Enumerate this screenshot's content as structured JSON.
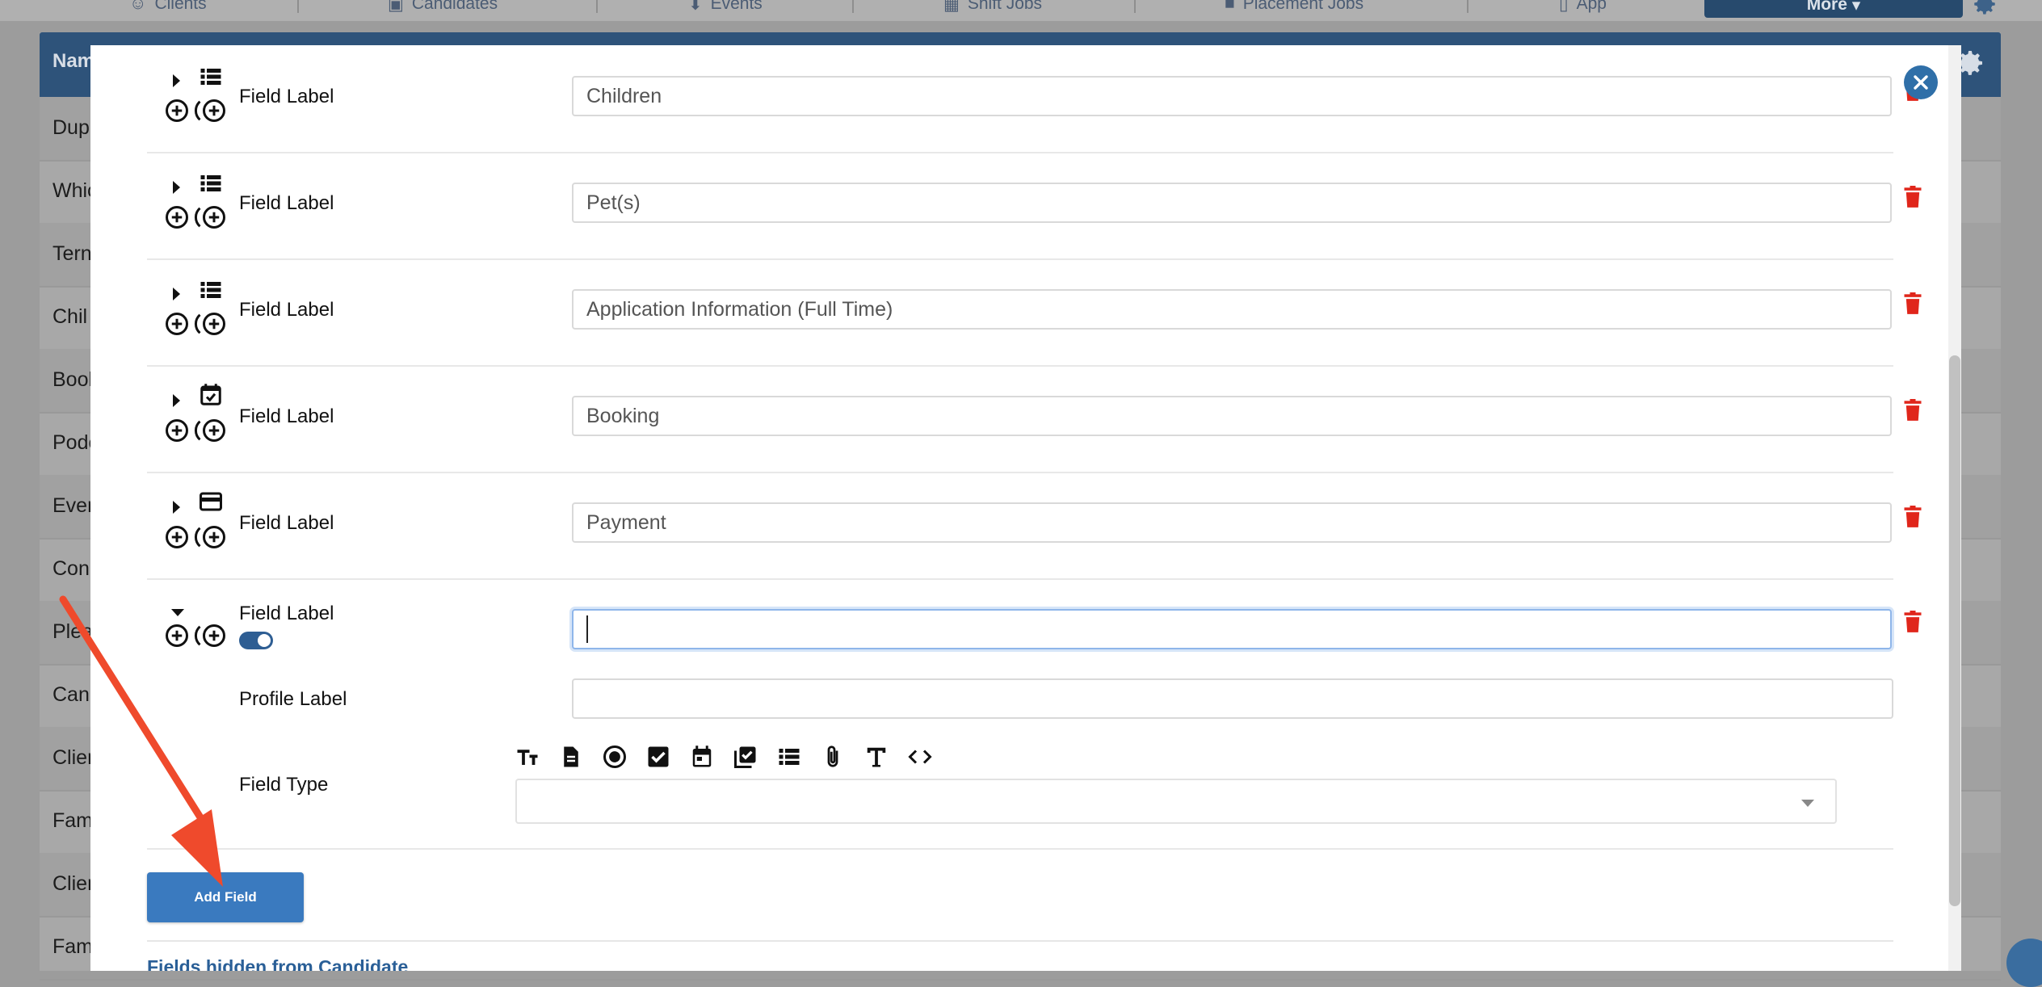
{
  "background": {
    "nav_items": [
      "Clients",
      "Candidates",
      "Events",
      "Shift Jobs",
      "Placement Jobs",
      "App"
    ],
    "more_label": "More",
    "table_header_label": "Nam",
    "rows": [
      "Dup",
      "Whic",
      "Tern",
      "Chil",
      "Bool",
      "Podc",
      "Ever",
      "Con",
      "Plea",
      "Can",
      "Clien",
      "Fam",
      "Clien",
      "Fam"
    ]
  },
  "modal": {
    "fields": [
      {
        "label": "Field Label",
        "value": "Children",
        "type_icon": "list-icon"
      },
      {
        "label": "Field Label",
        "value": "Pet(s)",
        "type_icon": "list-icon"
      },
      {
        "label": "Field Label",
        "value": "Application Information (Full Time)",
        "type_icon": "list-icon"
      },
      {
        "label": "Field Label",
        "value": "Booking",
        "type_icon": "calendar-check-icon"
      },
      {
        "label": "Field Label",
        "value": "Payment",
        "type_icon": "credit-card-icon"
      }
    ],
    "expanded_field": {
      "label": "Field Label",
      "value": "",
      "profile_label": "Profile Label",
      "profile_value": "",
      "field_type_label": "Field Type",
      "field_type_value": "",
      "type_tools": [
        "text-size-icon",
        "document-icon",
        "radio-icon",
        "checkbox-icon",
        "calendar-icon",
        "multi-check-icon",
        "list-icon",
        "paperclip-icon",
        "text-icon",
        "code-icon"
      ],
      "toggle_on": true
    },
    "add_field_label": "Add Field",
    "section_title": "Fields hidden from Candidate"
  },
  "colors": {
    "primary": "#3a7abf",
    "trash": "#e0261b",
    "arrow": "#ef4a2c"
  }
}
